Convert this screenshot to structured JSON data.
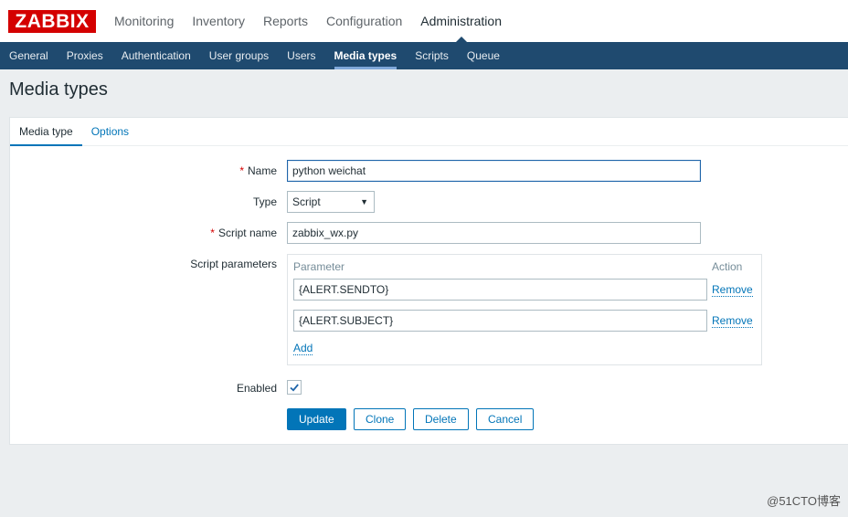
{
  "logo": {
    "text": "ZABBIX",
    "color": "#d40000"
  },
  "top_menu": [
    {
      "label": "Monitoring"
    },
    {
      "label": "Inventory"
    },
    {
      "label": "Reports"
    },
    {
      "label": "Configuration"
    },
    {
      "label": "Administration",
      "active": true
    }
  ],
  "sub_menu": [
    {
      "label": "General"
    },
    {
      "label": "Proxies"
    },
    {
      "label": "Authentication"
    },
    {
      "label": "User groups"
    },
    {
      "label": "Users"
    },
    {
      "label": "Media types",
      "active": true
    },
    {
      "label": "Scripts"
    },
    {
      "label": "Queue"
    }
  ],
  "page_title": "Media types",
  "tabs": [
    {
      "label": "Media type",
      "active": true
    },
    {
      "label": "Options"
    }
  ],
  "form": {
    "name_label": "Name",
    "name_value": "python weichat",
    "type_label": "Type",
    "type_value": "Script",
    "script_name_label": "Script name",
    "script_name_value": "zabbix_wx.py",
    "script_params_label": "Script parameters",
    "params_header_parameter": "Parameter",
    "params_header_action": "Action",
    "params": [
      {
        "value": "{ALERT.SENDTO}",
        "action": "Remove"
      },
      {
        "value": "{ALERT.SUBJECT}",
        "action": "Remove"
      }
    ],
    "add_label": "Add",
    "enabled_label": "Enabled",
    "enabled": true,
    "required_mark": "*"
  },
  "buttons": {
    "update": "Update",
    "clone": "Clone",
    "delete": "Delete",
    "cancel": "Cancel"
  },
  "watermark": "@51CTO博客",
  "colors": {
    "nav_dark": "#1f4a6f",
    "accent": "#0275b8",
    "background": "#ebeef0"
  }
}
